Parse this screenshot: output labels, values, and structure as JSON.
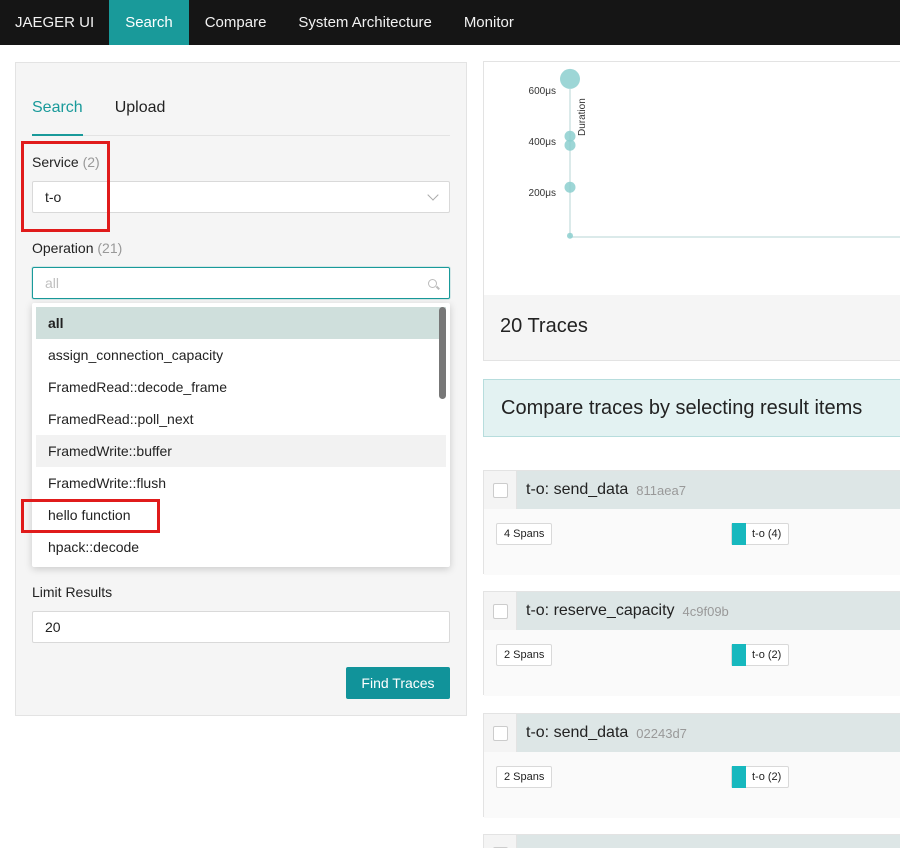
{
  "nav": {
    "brand": "JAEGER UI",
    "items": [
      "Search",
      "Compare",
      "System Architecture",
      "Monitor"
    ],
    "active": "Search"
  },
  "search_panel": {
    "tabs": [
      "Search",
      "Upload"
    ],
    "active_tab": "Search",
    "service": {
      "label": "Service",
      "count": "(2)",
      "value": "t-o"
    },
    "operation": {
      "label": "Operation",
      "count": "(21)",
      "placeholder": "all",
      "options": [
        "all",
        "assign_connection_capacity",
        "FramedRead::decode_frame",
        "FramedRead::poll_next",
        "FramedWrite::buffer",
        "FramedWrite::flush",
        "hello function",
        "hpack::decode"
      ],
      "selected": "all",
      "hovered": "FramedWrite::buffer"
    },
    "limit": {
      "label": "Limit Results",
      "value": "20"
    },
    "find_button": "Find Traces"
  },
  "scatter": {
    "y_ticks": [
      "600μs",
      "400μs",
      "200μs"
    ],
    "y_axis_label": "Duration"
  },
  "chart_data": {
    "type": "scatter",
    "ylabel": "Duration",
    "y_unit": "μs",
    "yticks": [
      200,
      400,
      600
    ],
    "points": [
      {
        "y": 620,
        "size": "large"
      },
      {
        "y": 395,
        "size": "medium"
      },
      {
        "y": 360,
        "size": "medium"
      },
      {
        "y": 195,
        "size": "medium"
      },
      {
        "y": 5,
        "size": "small"
      }
    ],
    "color": "#8ccfcf"
  },
  "results": {
    "count_text": "20 Traces",
    "compare_text": "Compare traces by selecting result items",
    "traces": [
      {
        "title": "t-o: send_data",
        "id": "811aea7",
        "spans": "4 Spans",
        "service": "t-o (4)"
      },
      {
        "title": "t-o: reserve_capacity",
        "id": "4c9f09b",
        "spans": "2 Spans",
        "service": "t-o (2)"
      },
      {
        "title": "t-o: send_data",
        "id": "02243d7",
        "spans": "2 Spans",
        "service": "t-o (2)"
      }
    ]
  },
  "colors": {
    "nav_bg": "#151515",
    "accent": "#199a9a",
    "highlight": "#e01b1b",
    "service_swatch": "#17b8be"
  }
}
